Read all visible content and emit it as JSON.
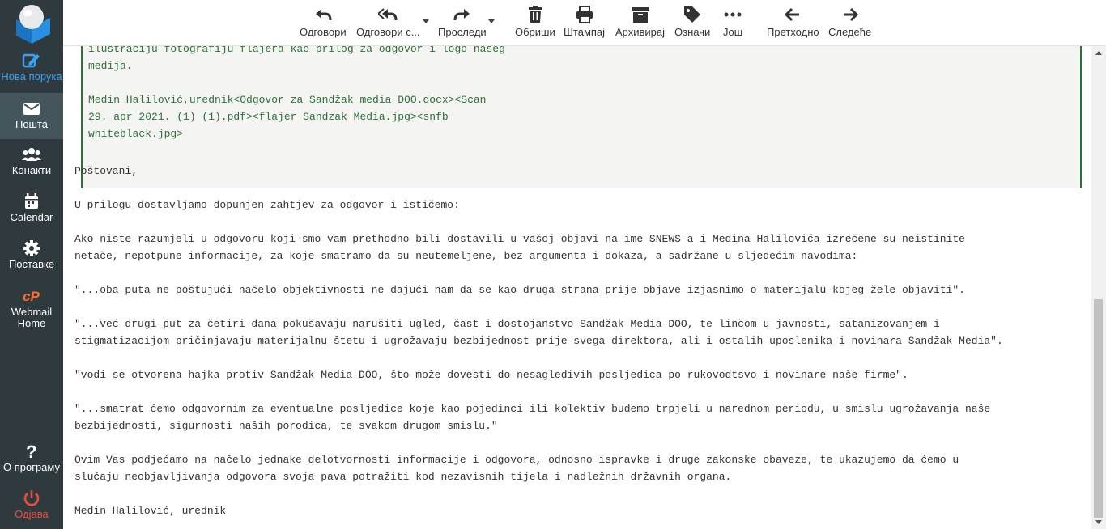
{
  "sidebar": {
    "items": [
      {
        "label": "Нова порука",
        "icon": "compose-icon"
      },
      {
        "label": "Пошта",
        "icon": "envelope-icon"
      },
      {
        "label": "Конакти",
        "icon": "contacts-icon"
      },
      {
        "label": "Calendar",
        "icon": "calendar-icon"
      },
      {
        "label": "Поставке",
        "icon": "gear-icon"
      },
      {
        "label": "Webmail Home",
        "icon": "cpanel-icon"
      },
      {
        "label": "О програму",
        "icon": "question-icon"
      },
      {
        "label": "Одјава",
        "icon": "power-icon"
      }
    ],
    "accent_color": "#3aa0f0",
    "logout_color": "#e84e40"
  },
  "toolbar": {
    "reply": "Одговори",
    "reply_all": "Одговори с...",
    "forward": "Проследи",
    "delete": "Обриши",
    "print": "Штампај",
    "archive": "Архивирај",
    "mark": "Означи",
    "more": "Још",
    "prev": "Претходно",
    "next": "Следеће"
  },
  "message": {
    "quote_lines": [
      "ilustraciju-fotografiju flajera kao prilog za odgovor i logo našeg",
      "medija.",
      "",
      "Medin Halilović,urednik<Odgovor za Sandžak media DOO.docx><Scan",
      "29. apr 2021. (1) (1).pdf><flajer Sandzak Media.jpg><snfb",
      "whiteblack.jpg>"
    ],
    "body_lines": [
      "Poštovani,",
      "",
      "U prilogu dostavljamo dopunjen zahtjev za odgovor i ističemo:",
      "",
      "Ako niste razumjeli u odgovoru koji smo vam prethodno bili dostavili u vašoj objavi na ime SNEWS-a i Medina Halilovića izrečene su neistinite",
      "netače, nepotpune informacije, za koje smatramo da su neutemeljene, bez argumenta i dokaza, a sadržane u sljedećim navodima:",
      "",
      "\"...oba puta ne poštujući načelo objektivnosti ne dajući nam da se kao druga strana prije objave izjasnimo o materijalu kojeg žele objaviti\".",
      "",
      "\"...već drugi put za četiri dana pokušavaju narušiti ugled, čast i dostojanstvo Sandžak Media DOO, te linčom u javnosti, satanizovanjem i",
      "stigmatizacijom pričinjavaju materijalnu štetu i ugrožavaju bezbijednost prije svega direktora, ali i ostalih uposlenika i novinara Sandžak Media\".",
      "",
      "\"vodi se otvorena hajka protiv Sandžak Media DOO, što može dovesti do nesagledivih posljedica po rukovodtsvo i novinare naše firme\".",
      "",
      "\"...smatrat ćemo odgovornim za eventualne posljedice koje kao pojedinci ili kolektiv budemo trpjeli u narednom periodu, u smislu ugrožavanja naše",
      "bezbijednosti, sigurnosti naših porodica, te svakom drugom smislu.\"",
      "",
      "Ovim Vas podjećamo na načelo jednake delotvornosti informacije i odgovora, odnosno ispravke i druge zakonske obaveze, te ukazujemo da ćemo u",
      "slučaju neobjavljivanja odgovora svoja pava potražiti kod nezavisnih tijela i nadležnih državnih organa.",
      "",
      "Medin Halilović, urednik"
    ],
    "quote_color": "#2f6f3a"
  }
}
